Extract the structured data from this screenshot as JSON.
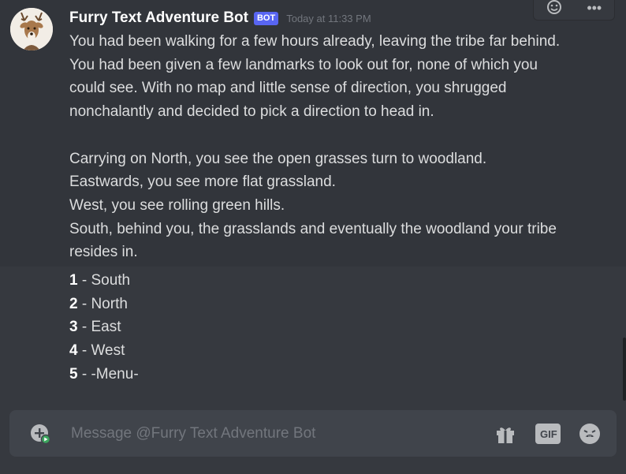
{
  "message": {
    "username": "Furry Text Adventure Bot",
    "bot_tag": "BOT",
    "timestamp": "Today at 11:33 PM",
    "paragraph1": "You had been walking for a few hours already, leaving the tribe far behind. You had been given a few landmarks to look out for, none of which you could see. With no map and little sense of direction, you shrugged nonchalantly and decided to pick a direction to head in.",
    "line_north": "Carrying on North, you see the open grasses turn to woodland.",
    "line_east": "Eastwards, you see more flat grassland.",
    "line_west": "West, you see rolling green hills.",
    "line_south": "South, behind you, the grasslands and eventually the woodland your tribe resides in."
  },
  "options": [
    {
      "num": "1",
      "label": " - South"
    },
    {
      "num": "2",
      "label": " - North"
    },
    {
      "num": "3",
      "label": " - East"
    },
    {
      "num": "4",
      "label": " - West"
    },
    {
      "num": "5",
      "label": " - -Menu-"
    }
  ],
  "message_actions": {
    "add_reaction_icon": "add-reaction-icon",
    "more_icon": "more-icon",
    "more_label": "•••"
  },
  "composer": {
    "placeholder": "Message @Furry Text Adventure Bot",
    "gif_label": "GIF",
    "icons": [
      "add-attachment-icon",
      "gift-icon",
      "gif-icon",
      "emoji-icon"
    ]
  },
  "colors": {
    "background": "#36393f",
    "message_hover": "#32353b",
    "composer": "#40444b",
    "bot_tag": "#5865f2",
    "add_badge": "#3ba55d"
  }
}
